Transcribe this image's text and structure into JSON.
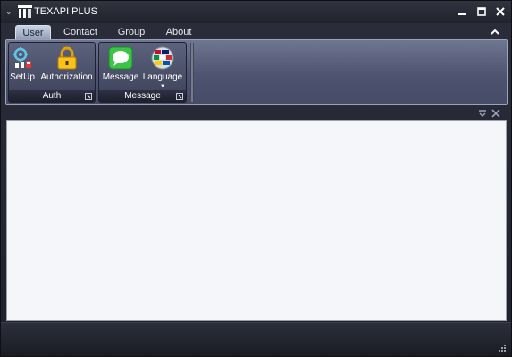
{
  "app": {
    "title": "TEXAPI PLUS",
    "logo_icon": "texapi-logo-icon",
    "accent_color": "#c9d3e6",
    "background_color": "#252833"
  },
  "window_controls": {
    "system_menu_icon": "chevron-down-icon",
    "minimize_icon": "minimize-icon",
    "maximize_icon": "maximize-icon",
    "close_icon": "close-icon"
  },
  "tabs": [
    {
      "label": "User",
      "selected": true
    },
    {
      "label": "Contact",
      "selected": false
    },
    {
      "label": "Group",
      "selected": false
    },
    {
      "label": "About",
      "selected": false
    }
  ],
  "ribbon": {
    "collapse_icon": "chevron-up-icon",
    "groups": [
      {
        "label": "Auth",
        "launcher_icon": "dialog-launcher-icon",
        "buttons": [
          {
            "label": "SetUp",
            "icon": "gear-setup-icon"
          },
          {
            "label": "Authorization",
            "icon": "padlock-icon"
          }
        ]
      },
      {
        "label": "Message",
        "launcher_icon": "dialog-launcher-icon",
        "buttons": [
          {
            "label": "Message",
            "icon": "message-bubble-icon"
          },
          {
            "label": "Language",
            "icon": "flags-globe-icon",
            "has_dropdown": true
          }
        ]
      }
    ]
  },
  "panel": {
    "pin_icon": "pin-icon",
    "close_icon": "close-icon",
    "content_color": "#f4f6f9"
  },
  "statusbar": {
    "grip_icon": "resize-grip-icon"
  }
}
